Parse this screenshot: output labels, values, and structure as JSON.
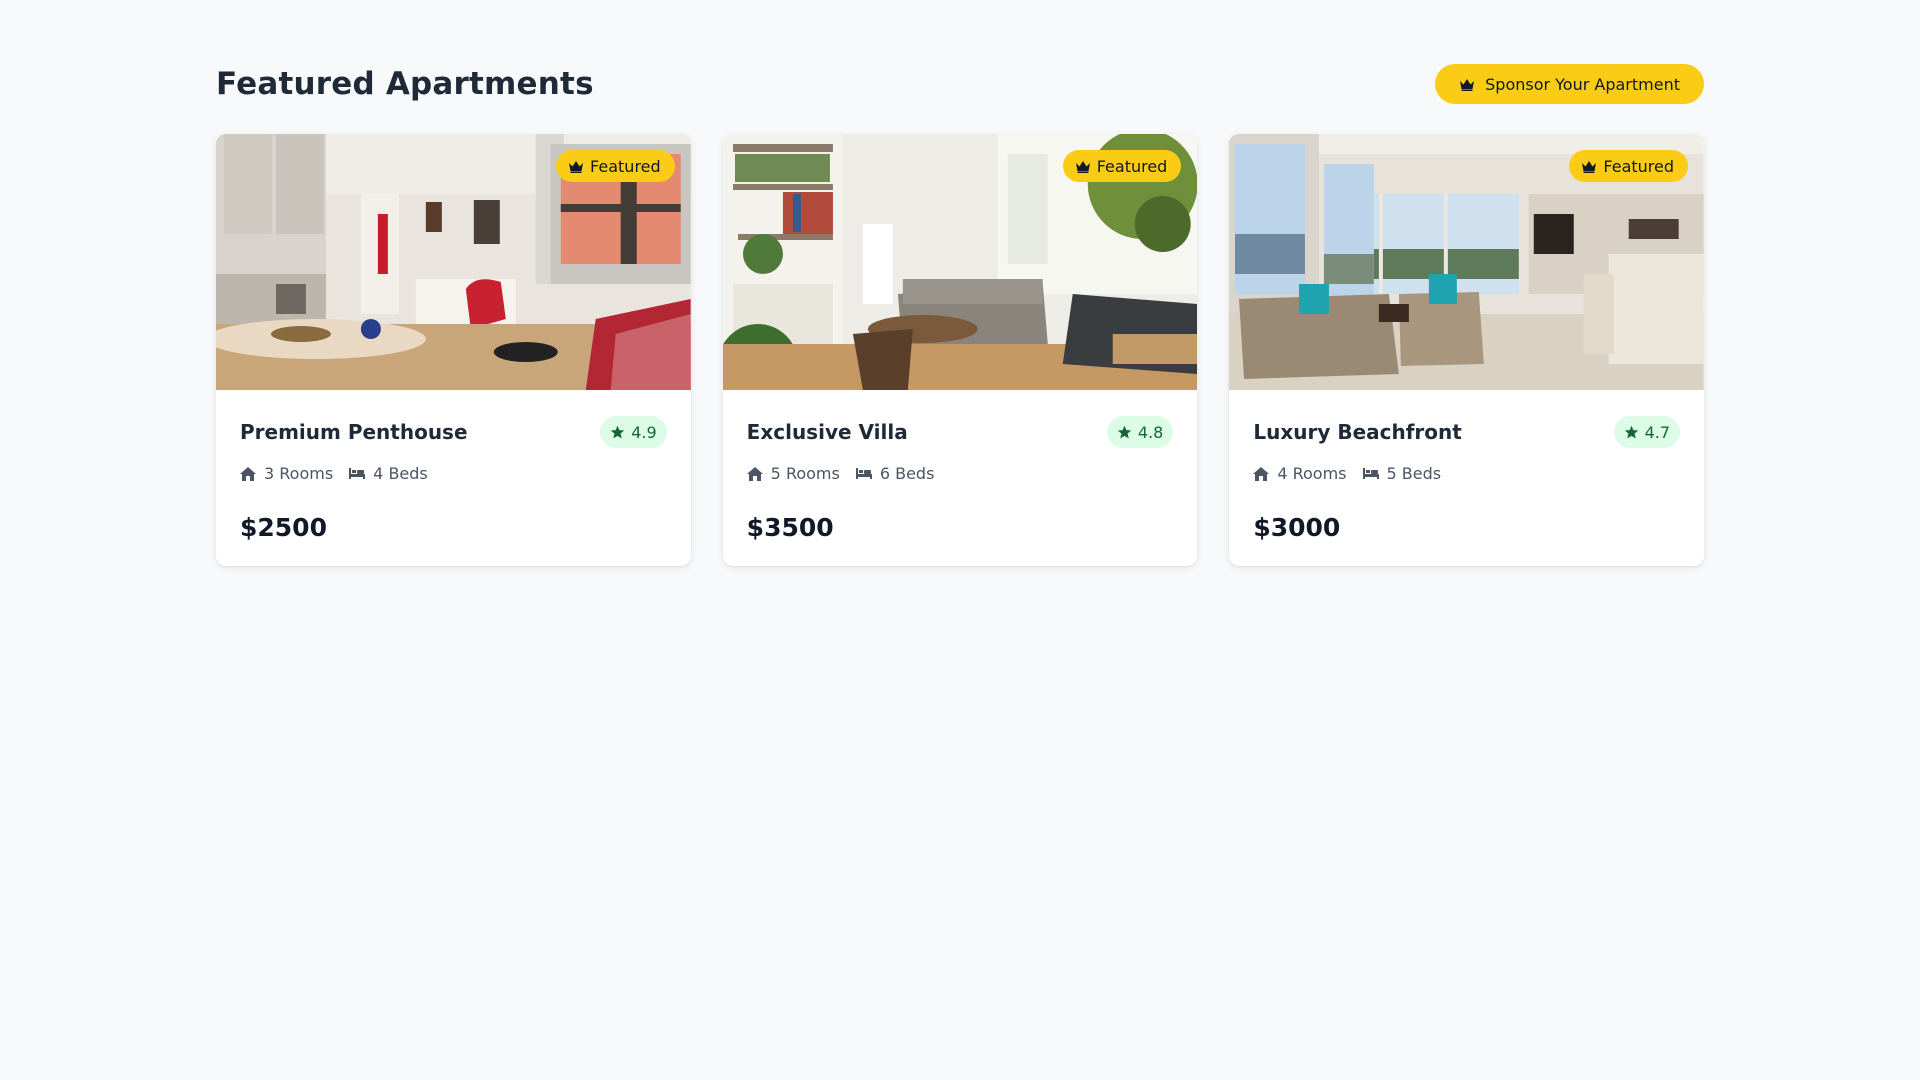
{
  "header": {
    "title": "Featured Apartments",
    "sponsor_label": "Sponsor Your Apartment",
    "sponsor_icon": "crown-icon"
  },
  "colors": {
    "accent": "#facc15",
    "rating_bg": "#dcfce7",
    "rating_text": "#166534"
  },
  "cards": [
    {
      "title": "Premium Penthouse",
      "badge": "Featured",
      "rating": "4.9",
      "rooms": "3 Rooms",
      "beds": "4 Beds",
      "price": "$2500"
    },
    {
      "title": "Exclusive Villa",
      "badge": "Featured",
      "rating": "4.8",
      "rooms": "5 Rooms",
      "beds": "6 Beds",
      "price": "$3500"
    },
    {
      "title": "Luxury Beachfront",
      "badge": "Featured",
      "rating": "4.7",
      "rooms": "4 Rooms",
      "beds": "5 Beds",
      "price": "$3000"
    }
  ]
}
